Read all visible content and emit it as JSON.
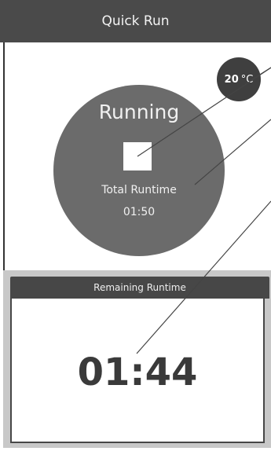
{
  "header": {
    "title": "Quick Run"
  },
  "temperature": {
    "value": "20",
    "unit": "°C"
  },
  "status": {
    "label": "Running",
    "total_runtime_label": "Total Runtime",
    "total_runtime_value": "01:50"
  },
  "remaining": {
    "label": "Remaining Runtime",
    "value": "01:44"
  },
  "colors": {
    "title_bar": "#4a4a4a",
    "circle": "#6b6b6b",
    "badge": "#3f3f3f",
    "panel_bg": "#c8c8c8"
  },
  "icons": [
    "stop-icon"
  ]
}
